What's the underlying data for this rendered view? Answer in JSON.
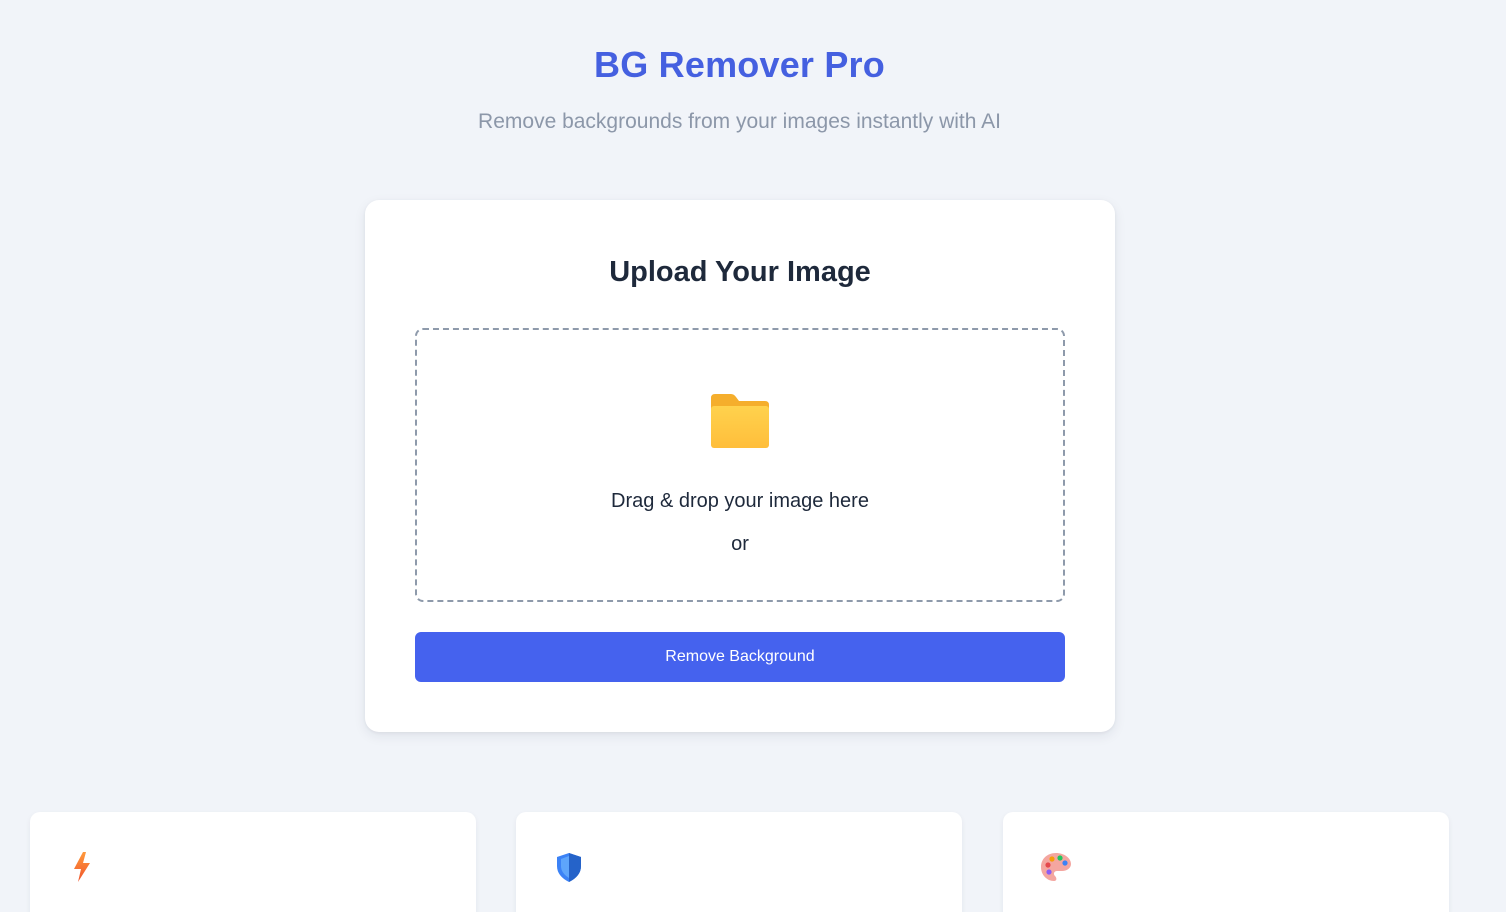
{
  "header": {
    "title": "BG Remover Pro",
    "subtitle": "Remove backgrounds from your images instantly with AI"
  },
  "upload": {
    "title": "Upload Your Image",
    "drop_text": "Drag & drop your image here",
    "or_text": "or",
    "button_label": "Remove Background",
    "icon": "folder-icon"
  },
  "features": [
    {
      "icon": "lightning-icon"
    },
    {
      "icon": "shield-icon"
    },
    {
      "icon": "palette-icon"
    }
  ],
  "colors": {
    "accent": "#4560e0",
    "button": "#4562ee",
    "background": "#f1f4f9",
    "text_dark": "#1e293b",
    "text_muted": "#8c97a9"
  }
}
